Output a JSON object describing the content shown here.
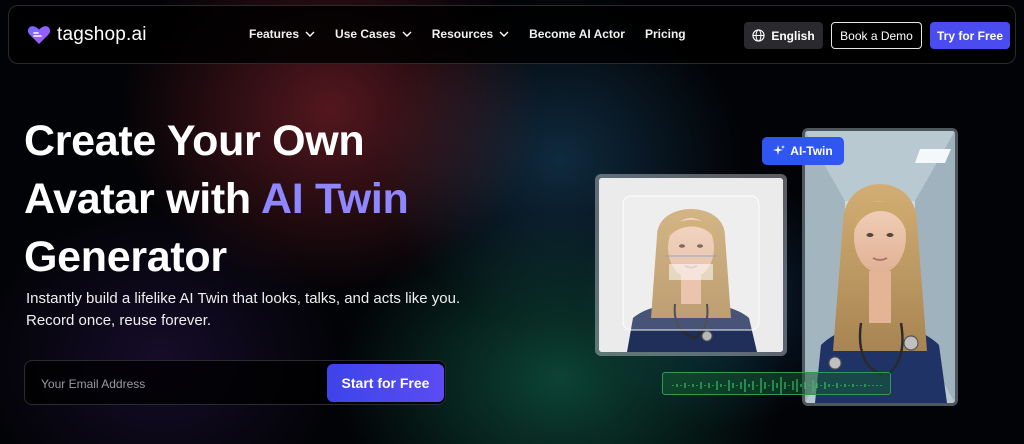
{
  "brand": {
    "name": "tagshop.ai",
    "accent": "#8f87ff",
    "primary": "#4b4cf0"
  },
  "nav": {
    "items": [
      {
        "label": "Features",
        "has_dropdown": true
      },
      {
        "label": "Use Cases",
        "has_dropdown": true
      },
      {
        "label": "Resources",
        "has_dropdown": true
      },
      {
        "label": "Become AI Actor",
        "has_dropdown": false
      },
      {
        "label": "Pricing",
        "has_dropdown": false
      }
    ],
    "language_label": "English",
    "language_icon": "globe-icon",
    "demo_label": "Book a Demo",
    "try_label": "Try for Free"
  },
  "hero": {
    "title_line1": "Create Your Own",
    "title_line2_pre": "Avatar with ",
    "title_line2_accent": "AI Twin",
    "title_line3": "Generator",
    "subtitle_line1": "Instantly build a lifelike AI Twin that looks, talks, and acts like you.",
    "subtitle_line2": "Record once, reuse forever.",
    "email_placeholder": "Your Email Address",
    "start_label": "Start for Free"
  },
  "visual": {
    "badge_label": "AI-Twin",
    "badge_icon": "sparkle-icon"
  }
}
